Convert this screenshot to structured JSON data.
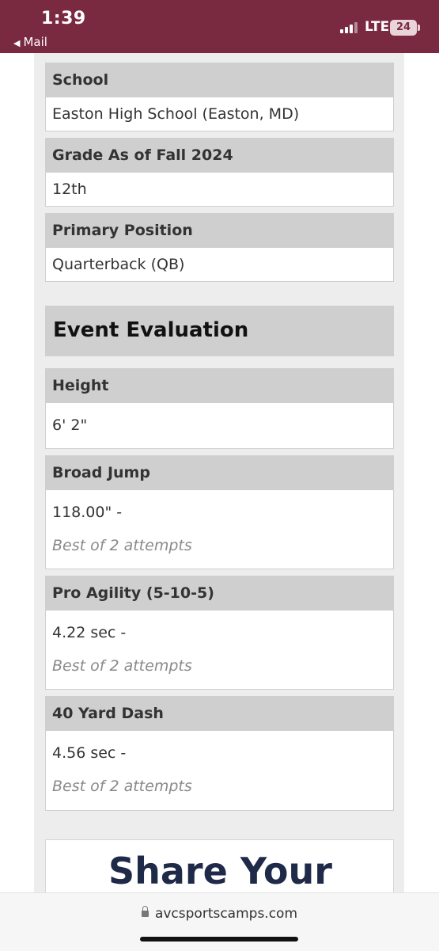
{
  "status_bar": {
    "time": "1:39",
    "back_label": "Mail",
    "network": "LTE",
    "battery": "24"
  },
  "fields": [
    {
      "label": "School",
      "value": "Easton High School (Easton, MD)"
    },
    {
      "label": "Grade As of Fall 2024",
      "value": "12th"
    },
    {
      "label": "Primary Position",
      "value": "Quarterback (QB)"
    }
  ],
  "evaluation": {
    "title": "Event Evaluation",
    "items": [
      {
        "label": "Height",
        "value": "6' 2\""
      },
      {
        "label": "Broad Jump",
        "value": "118.00\"  -",
        "note": "Best of 2 attempts"
      },
      {
        "label": "Pro Agility (5-10-5)",
        "value": "4.22 sec  -",
        "note": "Best of 2 attempts"
      },
      {
        "label": "40 Yard Dash",
        "value": "4.56 sec  -",
        "note": "Best of 2 attempts"
      }
    ]
  },
  "share": {
    "title": "Share Your"
  },
  "browser": {
    "url": "avcsportscamps.com"
  }
}
